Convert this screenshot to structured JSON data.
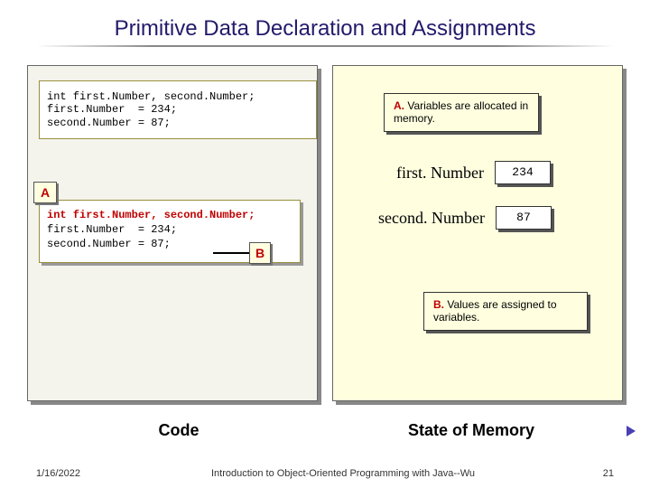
{
  "title": "Primitive Data Declaration and Assignments",
  "code_block": "int first.Number, second.Number;\nfirst.Number  = 234;\nsecond.Number = 87;",
  "code_a": {
    "line1": "int first.Number, second.Number;",
    "line2": "first.Number  = 234;",
    "line3": "second.Number = 87;"
  },
  "badges": {
    "a": "A",
    "b": "B"
  },
  "annotations": {
    "a_prefix": "A.",
    "a_text": " Variables are allocated in memory.",
    "b_prefix": "B.",
    "b_text": " Values are assigned to variables."
  },
  "vars": {
    "first_name": "first. Number",
    "first_value": "234",
    "second_name": "second. Number",
    "second_value": "87"
  },
  "labels": {
    "code": "Code",
    "state": "State of Memory"
  },
  "footer": {
    "date": "1/16/2022",
    "course": "Introduction to Object-Oriented Programming with Java--Wu",
    "page": "21"
  }
}
